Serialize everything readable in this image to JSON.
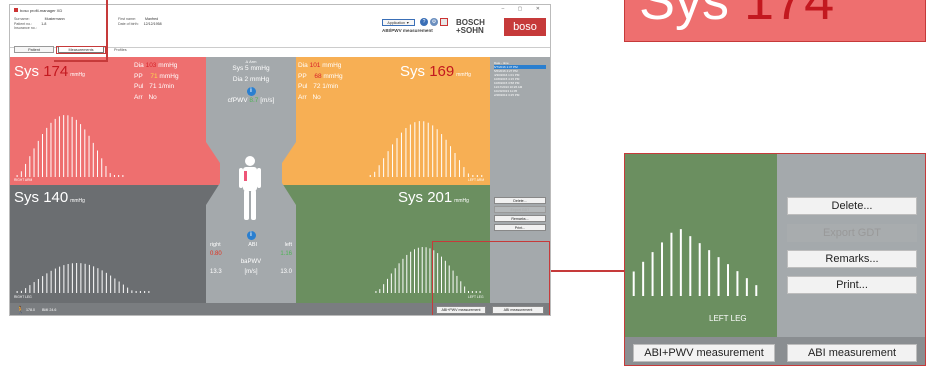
{
  "app": {
    "title": "boso profil-manager XD",
    "window_controls": "– ▢ ✕"
  },
  "patient": {
    "surname_label": "Surname:",
    "surname": "Mustermann",
    "patno_label": "Patient no.:",
    "patno": "1-8",
    "insurance_label": "Insurance no.:",
    "firstname_label": "First name:",
    "firstname": "Manfred",
    "dob_label": "Date of birth:",
    "dob": "12/12/1958"
  },
  "tabs": [
    {
      "label": "Patient"
    },
    {
      "label": "Measurements"
    },
    {
      "label": "Profiles"
    }
  ],
  "header": {
    "app_dropdown": "Application ▼",
    "mode": "ABI/PWV measurement",
    "brand1": "BOSCH",
    "brand2": "+SOHN",
    "brand3": "boso"
  },
  "right_arm": {
    "sys_label": "Sys",
    "sys": "174",
    "unit": "mmHg",
    "dia_label": "Dia",
    "dia": "103",
    "pp_label": "PP",
    "pp": "71",
    "pul_label": "Pul",
    "pul": "71",
    "pul_unit": "1/min",
    "arr_label": "Arr",
    "arr": "No",
    "footer": "RIGHT ARM"
  },
  "left_arm": {
    "sys_label": "Sys",
    "sys": "169",
    "unit": "mmHg",
    "dia_label": "Dia",
    "dia": "101",
    "pp_label": "PP",
    "pp": "68",
    "pul_label": "Pul",
    "pul": "72",
    "pul_unit": "1/min",
    "arr_label": "Arr",
    "arr": "No",
    "footer": "LEFT ARM"
  },
  "center_top": {
    "title": "Δ Arm",
    "sys_label": "Sys",
    "sys": "5",
    "dia_label": "Dia",
    "dia": "2",
    "unit": "mmHg",
    "cfpwv_label": "cfPWV",
    "cfpwv": "8.7",
    "cfpwv_unit": "[m/s]"
  },
  "center_bottom": {
    "right": "right",
    "abi": "ABI",
    "left": "left",
    "abi_right": "0.80",
    "abi_left": "1.16",
    "bapwv": "baPWV",
    "pwv_right": "13.3",
    "pwv_unit": "[m/s]",
    "pwv_left": "13.0"
  },
  "right_leg": {
    "sys_label": "Sys",
    "sys": "140",
    "unit": "mmHg",
    "footer": "RIGHT LEG"
  },
  "left_leg": {
    "sys_label": "Sys",
    "sys": "201",
    "unit": "mmHg",
    "footer": "LEFT LEG"
  },
  "dates": {
    "header": "Date - time",
    "items": [
      "6/7/2016 1:37 PM",
      "5/6/2016 4:27 PM",
      "4/30/2016 1:01 PM",
      "10/8/2015 4:15 PM",
      "10/8/2015 3:58 PM",
      "11/17/2013 10:26 AM",
      "10/20/2013 11:05",
      "2/28/2013 3:25 PM"
    ]
  },
  "actions": {
    "delete": "Delete...",
    "export": "Export GDT",
    "remarks": "Remarks...",
    "print": "Print..."
  },
  "modes": {
    "abi_pwv": "ABI+PWV measurement",
    "abi": "ABI measurement"
  },
  "statusbar": {
    "height": "178.0",
    "bmi": "BMI 24.6"
  },
  "callout_top": {
    "sys_label": "Sys",
    "sys": "174"
  },
  "callout_zoom": {
    "footer": "LEFT LEG",
    "delete": "Delete...",
    "export": "Export GDT",
    "remarks": "Remarks...",
    "print": "Print...",
    "abi_pwv": "ABI+PWV measurement",
    "abi": "ABI measurement"
  },
  "colors": {
    "right_arm": "#ee6f6f",
    "left_arm": "#f7af54",
    "right_leg": "#6b6e71",
    "left_leg": "#6b8f60",
    "center": "#a4a9ac",
    "callout": "#c63a3a"
  },
  "icons": {
    "info": "info-icon",
    "person": "person-icon",
    "help": "help-icon",
    "settings": "gear-icon"
  }
}
